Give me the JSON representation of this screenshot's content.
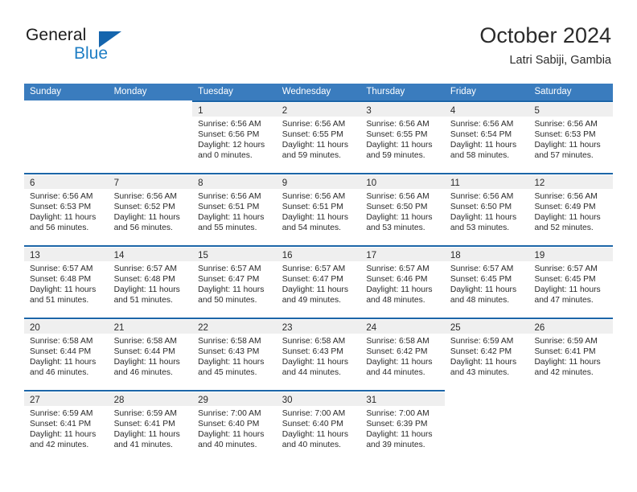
{
  "brand": {
    "name_top": "General",
    "name_bottom": "Blue",
    "accent_color": "#1f7ec4",
    "triangle_color": "#1565ad"
  },
  "header": {
    "title": "October 2024",
    "subtitle": "Latri Sabiji, Gambia"
  },
  "calendar": {
    "header_bg": "#3a7cbe",
    "header_text_color": "#ffffff",
    "row_separator_color": "#1d66a8",
    "daynum_band_color": "#efefef",
    "day_names": [
      "Sunday",
      "Monday",
      "Tuesday",
      "Wednesday",
      "Thursday",
      "Friday",
      "Saturday"
    ],
    "weeks": [
      [
        {
          "day": "",
          "lines": []
        },
        {
          "day": "",
          "lines": []
        },
        {
          "day": "1",
          "lines": [
            "Sunrise: 6:56 AM",
            "Sunset: 6:56 PM",
            "Daylight: 12 hours",
            "and 0 minutes."
          ]
        },
        {
          "day": "2",
          "lines": [
            "Sunrise: 6:56 AM",
            "Sunset: 6:55 PM",
            "Daylight: 11 hours",
            "and 59 minutes."
          ]
        },
        {
          "day": "3",
          "lines": [
            "Sunrise: 6:56 AM",
            "Sunset: 6:55 PM",
            "Daylight: 11 hours",
            "and 59 minutes."
          ]
        },
        {
          "day": "4",
          "lines": [
            "Sunrise: 6:56 AM",
            "Sunset: 6:54 PM",
            "Daylight: 11 hours",
            "and 58 minutes."
          ]
        },
        {
          "day": "5",
          "lines": [
            "Sunrise: 6:56 AM",
            "Sunset: 6:53 PM",
            "Daylight: 11 hours",
            "and 57 minutes."
          ]
        }
      ],
      [
        {
          "day": "6",
          "lines": [
            "Sunrise: 6:56 AM",
            "Sunset: 6:53 PM",
            "Daylight: 11 hours",
            "and 56 minutes."
          ]
        },
        {
          "day": "7",
          "lines": [
            "Sunrise: 6:56 AM",
            "Sunset: 6:52 PM",
            "Daylight: 11 hours",
            "and 56 minutes."
          ]
        },
        {
          "day": "8",
          "lines": [
            "Sunrise: 6:56 AM",
            "Sunset: 6:51 PM",
            "Daylight: 11 hours",
            "and 55 minutes."
          ]
        },
        {
          "day": "9",
          "lines": [
            "Sunrise: 6:56 AM",
            "Sunset: 6:51 PM",
            "Daylight: 11 hours",
            "and 54 minutes."
          ]
        },
        {
          "day": "10",
          "lines": [
            "Sunrise: 6:56 AM",
            "Sunset: 6:50 PM",
            "Daylight: 11 hours",
            "and 53 minutes."
          ]
        },
        {
          "day": "11",
          "lines": [
            "Sunrise: 6:56 AM",
            "Sunset: 6:50 PM",
            "Daylight: 11 hours",
            "and 53 minutes."
          ]
        },
        {
          "day": "12",
          "lines": [
            "Sunrise: 6:56 AM",
            "Sunset: 6:49 PM",
            "Daylight: 11 hours",
            "and 52 minutes."
          ]
        }
      ],
      [
        {
          "day": "13",
          "lines": [
            "Sunrise: 6:57 AM",
            "Sunset: 6:48 PM",
            "Daylight: 11 hours",
            "and 51 minutes."
          ]
        },
        {
          "day": "14",
          "lines": [
            "Sunrise: 6:57 AM",
            "Sunset: 6:48 PM",
            "Daylight: 11 hours",
            "and 51 minutes."
          ]
        },
        {
          "day": "15",
          "lines": [
            "Sunrise: 6:57 AM",
            "Sunset: 6:47 PM",
            "Daylight: 11 hours",
            "and 50 minutes."
          ]
        },
        {
          "day": "16",
          "lines": [
            "Sunrise: 6:57 AM",
            "Sunset: 6:47 PM",
            "Daylight: 11 hours",
            "and 49 minutes."
          ]
        },
        {
          "day": "17",
          "lines": [
            "Sunrise: 6:57 AM",
            "Sunset: 6:46 PM",
            "Daylight: 11 hours",
            "and 48 minutes."
          ]
        },
        {
          "day": "18",
          "lines": [
            "Sunrise: 6:57 AM",
            "Sunset: 6:45 PM",
            "Daylight: 11 hours",
            "and 48 minutes."
          ]
        },
        {
          "day": "19",
          "lines": [
            "Sunrise: 6:57 AM",
            "Sunset: 6:45 PM",
            "Daylight: 11 hours",
            "and 47 minutes."
          ]
        }
      ],
      [
        {
          "day": "20",
          "lines": [
            "Sunrise: 6:58 AM",
            "Sunset: 6:44 PM",
            "Daylight: 11 hours",
            "and 46 minutes."
          ]
        },
        {
          "day": "21",
          "lines": [
            "Sunrise: 6:58 AM",
            "Sunset: 6:44 PM",
            "Daylight: 11 hours",
            "and 46 minutes."
          ]
        },
        {
          "day": "22",
          "lines": [
            "Sunrise: 6:58 AM",
            "Sunset: 6:43 PM",
            "Daylight: 11 hours",
            "and 45 minutes."
          ]
        },
        {
          "day": "23",
          "lines": [
            "Sunrise: 6:58 AM",
            "Sunset: 6:43 PM",
            "Daylight: 11 hours",
            "and 44 minutes."
          ]
        },
        {
          "day": "24",
          "lines": [
            "Sunrise: 6:58 AM",
            "Sunset: 6:42 PM",
            "Daylight: 11 hours",
            "and 44 minutes."
          ]
        },
        {
          "day": "25",
          "lines": [
            "Sunrise: 6:59 AM",
            "Sunset: 6:42 PM",
            "Daylight: 11 hours",
            "and 43 minutes."
          ]
        },
        {
          "day": "26",
          "lines": [
            "Sunrise: 6:59 AM",
            "Sunset: 6:41 PM",
            "Daylight: 11 hours",
            "and 42 minutes."
          ]
        }
      ],
      [
        {
          "day": "27",
          "lines": [
            "Sunrise: 6:59 AM",
            "Sunset: 6:41 PM",
            "Daylight: 11 hours",
            "and 42 minutes."
          ]
        },
        {
          "day": "28",
          "lines": [
            "Sunrise: 6:59 AM",
            "Sunset: 6:41 PM",
            "Daylight: 11 hours",
            "and 41 minutes."
          ]
        },
        {
          "day": "29",
          "lines": [
            "Sunrise: 7:00 AM",
            "Sunset: 6:40 PM",
            "Daylight: 11 hours",
            "and 40 minutes."
          ]
        },
        {
          "day": "30",
          "lines": [
            "Sunrise: 7:00 AM",
            "Sunset: 6:40 PM",
            "Daylight: 11 hours",
            "and 40 minutes."
          ]
        },
        {
          "day": "31",
          "lines": [
            "Sunrise: 7:00 AM",
            "Sunset: 6:39 PM",
            "Daylight: 11 hours",
            "and 39 minutes."
          ]
        },
        {
          "day": "",
          "lines": []
        },
        {
          "day": "",
          "lines": []
        }
      ]
    ]
  }
}
